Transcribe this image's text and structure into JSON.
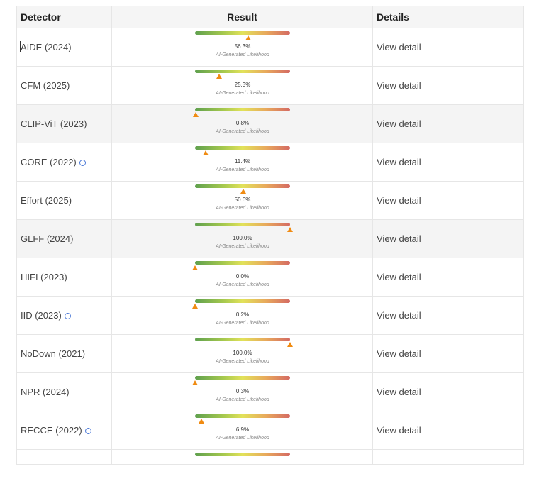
{
  "header": {
    "detector": "Detector",
    "result": "Result",
    "details": "Details"
  },
  "rows": [
    {
      "name": "AIDE (2024)",
      "pct": "56.3%",
      "value": 0.563,
      "caption": "AI-Generated Likelihood",
      "detail": "View detail",
      "info": false
    },
    {
      "name": "CFM (2025)",
      "pct": "25.3%",
      "value": 0.253,
      "caption": "AI-Generated Likelihood",
      "detail": "View detail",
      "info": false
    },
    {
      "name": "CLIP-ViT (2023)",
      "pct": "0.8%",
      "value": 0.008,
      "caption": "AI-Generated Likelihood",
      "detail": "View detail",
      "info": false
    },
    {
      "name": "CORE (2022)",
      "pct": "11.4%",
      "value": 0.114,
      "caption": "AI-Generated Likelihood",
      "detail": "View detail",
      "info": true
    },
    {
      "name": "Effort (2025)",
      "pct": "50.6%",
      "value": 0.506,
      "caption": "AI-Generated Likelihood",
      "detail": "View detail",
      "info": false
    },
    {
      "name": "GLFF (2024)",
      "pct": "100.0%",
      "value": 1.0,
      "caption": "AI-Generated Likelihood",
      "detail": "View detail",
      "info": false
    },
    {
      "name": "HIFI (2023)",
      "pct": "0.0%",
      "value": 0.0,
      "caption": "AI-Generated Likelihood",
      "detail": "View detail",
      "info": false
    },
    {
      "name": "IID (2023)",
      "pct": "0.2%",
      "value": 0.002,
      "caption": "AI-Generated Likelihood",
      "detail": "View detail",
      "info": true
    },
    {
      "name": "NoDown (2021)",
      "pct": "100.0%",
      "value": 1.0,
      "caption": "AI-Generated Likelihood",
      "detail": "View detail",
      "info": false
    },
    {
      "name": "NPR (2024)",
      "pct": "0.3%",
      "value": 0.003,
      "caption": "AI-Generated Likelihood",
      "detail": "View detail",
      "info": false
    },
    {
      "name": "RECCE (2022)",
      "pct": "6.9%",
      "value": 0.069,
      "caption": "AI-Generated Likelihood",
      "detail": "View detail",
      "info": true
    }
  ],
  "colors": {
    "marker": "#f08b12",
    "info_icon": "#4a78d6"
  }
}
